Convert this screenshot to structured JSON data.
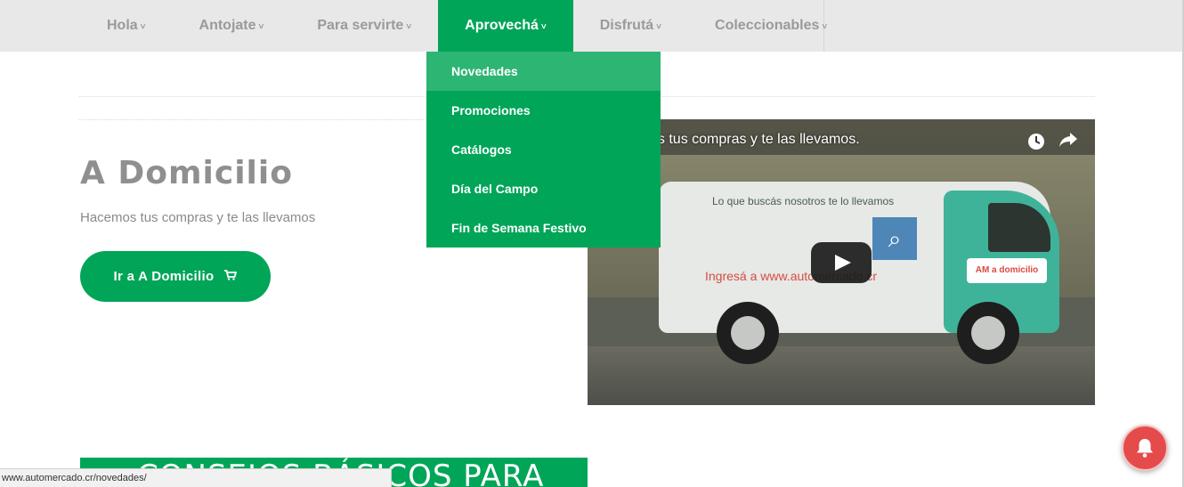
{
  "nav": {
    "items": [
      {
        "label": "Hola",
        "active": false
      },
      {
        "label": "Antojate",
        "active": false
      },
      {
        "label": "Para servirte",
        "active": false
      },
      {
        "label": "Aprovechá",
        "active": true
      },
      {
        "label": "Disfrutá",
        "active": false
      },
      {
        "label": "Coleccionables",
        "active": false
      }
    ],
    "chevron": "˅"
  },
  "dropdown": {
    "items": [
      {
        "label": "Novedades",
        "hover": true
      },
      {
        "label": "Promociones"
      },
      {
        "label": "Catálogos"
      },
      {
        "label": "Día del Campo"
      },
      {
        "label": "Fin de Semana Festivo"
      }
    ]
  },
  "main": {
    "heading": "A Domicilio",
    "subtext": "Hacemos tus compras y te las llevamos",
    "cta_label": "Ir a A Domicilio",
    "cta_icon": "cart-icon"
  },
  "video": {
    "title": "os tus compras y te las llevamos.",
    "van_slogan": "Lo que buscás nosotros te lo llevamos",
    "van_url": "Ingresá a www.automercado.cr",
    "van_logo": "AM a domicilio",
    "icons": [
      "clock-icon",
      "share-icon",
      "play-icon"
    ]
  },
  "banner": {
    "text": "CONSEJOS BÁSICOS PARA"
  },
  "statusbar": {
    "url": "www.automercado.cr/novedades/"
  },
  "colors": {
    "brand_green": "#00a558",
    "hover_green": "#2db574",
    "bell_red": "#e54b4b",
    "nav_bg": "#e8e8e8"
  }
}
